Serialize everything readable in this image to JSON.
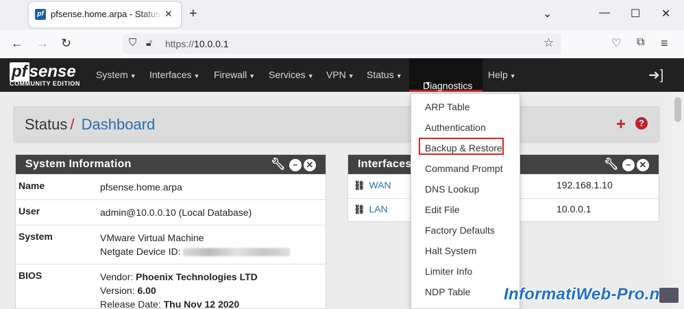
{
  "browser": {
    "tab_title": "pfsense.home.arpa - Status: Dashboard",
    "favicon": "pf",
    "url_scheme": "https://",
    "url_host": "10.0.0.1"
  },
  "pfsense": {
    "logo": "pfsense",
    "logo_sub": "COMMUNITY EDITION",
    "menu": [
      "System",
      "Interfaces",
      "Firewall",
      "Services",
      "VPN",
      "Status",
      "Diagnostics",
      "Help"
    ],
    "active_menu": "Diagnostics"
  },
  "breadcrumb": {
    "section": "Status",
    "separator": "/",
    "page": "Dashboard"
  },
  "system_info": {
    "title": "System Information",
    "rows": [
      {
        "key": "Name",
        "lines": [
          "pfsense.home.arpa"
        ]
      },
      {
        "key": "User",
        "lines": [
          "admin@10.0.0.10 (Local Database)"
        ]
      },
      {
        "key": "System",
        "lines": [
          "VMware Virtual Machine",
          "Netgate Device ID: "
        ]
      },
      {
        "key": "BIOS",
        "vendor_label": "Vendor: ",
        "vendor": "Phoenix Technologies LTD",
        "version_label": "Version: ",
        "version": "6.00",
        "release_label": "Release Date: ",
        "release": "Thu Nov 12 2020"
      }
    ]
  },
  "interfaces": {
    "title": "Interfaces",
    "rows": [
      {
        "name": "WAN",
        "ip": "192.168.1.10"
      },
      {
        "name": "LAN",
        "ip": "10.0.0.1"
      }
    ]
  },
  "diagnostics_menu": [
    "ARP Table",
    "Authentication",
    "Backup & Restore",
    "Command Prompt",
    "DNS Lookup",
    "Edit File",
    "Factory Defaults",
    "Halt System",
    "Limiter Info",
    "NDP Table"
  ],
  "highlighted_item": "Backup & Restore",
  "watermark": "InformatiWeb-Pro.net",
  "colors": {
    "accent_red": "#c0202a",
    "link_blue": "#2a6fb0",
    "navbar": "#212121",
    "panel_header": "#424242"
  }
}
